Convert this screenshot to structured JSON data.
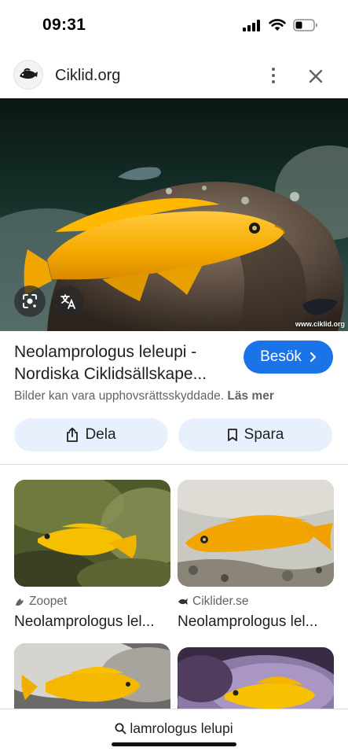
{
  "status_bar": {
    "time": "09:31"
  },
  "header": {
    "site_name": "Ciklid.org",
    "logo_icon": "fish-logo-icon",
    "more_icon": "more-vert-icon",
    "close_icon": "close-icon"
  },
  "hero": {
    "watermark": "www.ciklid.org",
    "lens_icon": "lens-icon",
    "translate_icon": "translate-icon"
  },
  "result": {
    "title_line1": "Neolamprologus leleupi -",
    "title_line2": "Nordiska Ciklidsällskape...",
    "visit_label": "Besök",
    "copyright_text": "Bilder kan vara upphovsrättsskyddade.",
    "learn_more": "Läs mer"
  },
  "actions": {
    "share_label": "Dela",
    "save_label": "Spara"
  },
  "related": [
    {
      "source": "Zoopet",
      "title": "Neolamprologus lel..."
    },
    {
      "source": "Ciklider.se",
      "title": "Neolamprologus lel..."
    },
    {
      "source": "",
      "title": ""
    },
    {
      "source": "",
      "title": ""
    }
  ],
  "bottom": {
    "query": "lamrologus lelupi"
  },
  "colors": {
    "accent": "#1a73e8",
    "chip_bg": "#e8f0fe",
    "fish_yellow": "#f5b400"
  }
}
